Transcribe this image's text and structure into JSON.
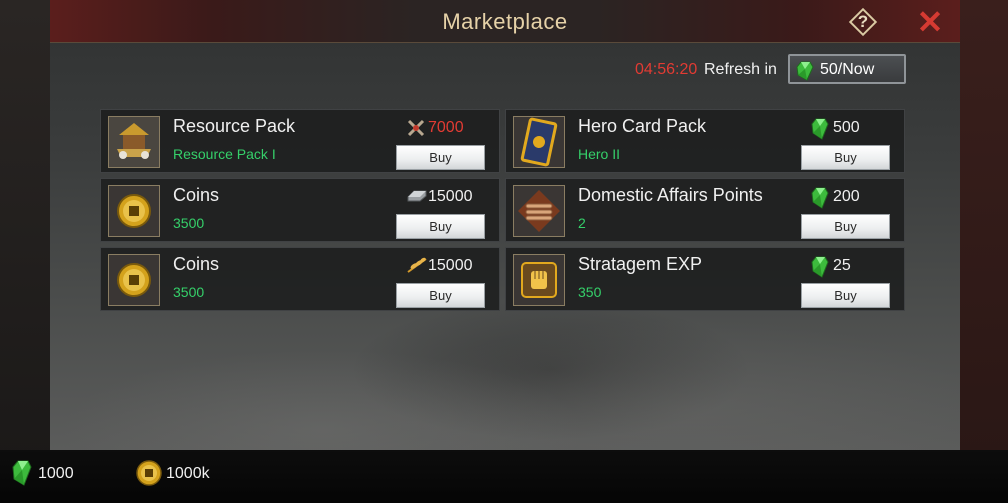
{
  "window": {
    "title": "Marketplace",
    "help_label": "?",
    "close_label": "✕"
  },
  "refresh": {
    "timer": "04:56:20",
    "label": "Refresh in",
    "cost": "50/Now"
  },
  "items": [
    {
      "name": "Resource Pack",
      "sub": "Resource Pack I",
      "price": "7000",
      "currency_icon": "crossed-swords-icon",
      "price_color": "#e23b33",
      "thumb_icon": "pavilion-icon",
      "buy": "Buy"
    },
    {
      "name": "Hero Card Pack",
      "sub": "Hero II",
      "price": "500",
      "currency_icon": "gem-icon",
      "price_color": "#f0f0f0",
      "thumb_icon": "hero-card-icon",
      "buy": "Buy"
    },
    {
      "name": "Coins",
      "sub": "3500",
      "price": "15000",
      "currency_icon": "iron-ingot-icon",
      "price_color": "#f0f0f0",
      "thumb_icon": "coin-icon",
      "buy": "Buy"
    },
    {
      "name": "Domestic Affairs Points",
      "sub": "2",
      "price": "200",
      "currency_icon": "gem-icon",
      "price_color": "#f0f0f0",
      "thumb_icon": "bamboo-scroll-icon",
      "buy": "Buy"
    },
    {
      "name": "Coins",
      "sub": "3500",
      "price": "15000",
      "currency_icon": "grain-icon",
      "price_color": "#f0f0f0",
      "thumb_icon": "coin-icon",
      "buy": "Buy"
    },
    {
      "name": "Stratagem EXP",
      "sub": "350",
      "price": "25",
      "currency_icon": "gem-icon",
      "price_color": "#f0f0f0",
      "thumb_icon": "fist-icon",
      "buy": "Buy"
    }
  ],
  "resources": [
    {
      "icon": "gem-icon",
      "value": "1000"
    },
    {
      "icon": "coin-icon",
      "value": "1000k"
    }
  ],
  "colors": {
    "accent_red": "#e23b33",
    "sub_green": "#35d06a",
    "title_gold": "#e6d2a8"
  }
}
